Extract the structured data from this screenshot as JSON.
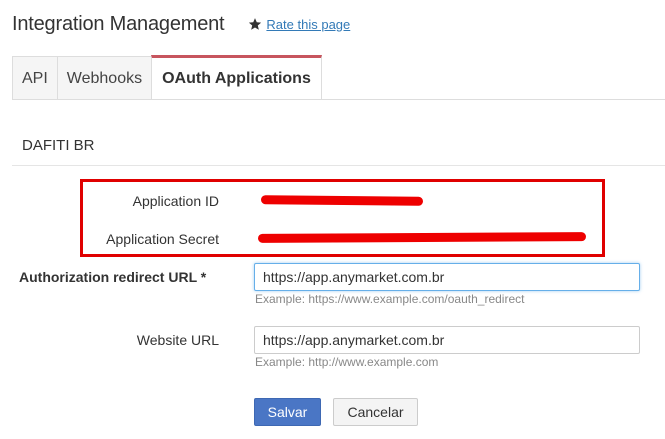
{
  "header": {
    "title": "Integration Management",
    "rate_label": "Rate this page"
  },
  "tabs": [
    {
      "label": "API",
      "active": false
    },
    {
      "label": "Webhooks",
      "active": false
    },
    {
      "label": "OAuth Applications",
      "active": true
    }
  ],
  "section": {
    "title": "DAFITI BR"
  },
  "credentials": {
    "app_id_label": "Application ID",
    "app_secret_label": "Application Secret"
  },
  "form": {
    "redirect_label": "Authorization redirect URL *",
    "redirect_value": "https://app.anymarket.com.br",
    "redirect_help": "Example: https://www.example.com/oauth_redirect",
    "website_label": "Website URL",
    "website_value": "https://app.anymarket.com.br",
    "website_help": "Example: http://www.example.com"
  },
  "buttons": {
    "save": "Salvar",
    "cancel": "Cancelar"
  },
  "colors": {
    "accent_tab": "#c7555e",
    "primary_button": "#4a76c5",
    "redaction": "#ee0000",
    "link": "#337ab7"
  }
}
